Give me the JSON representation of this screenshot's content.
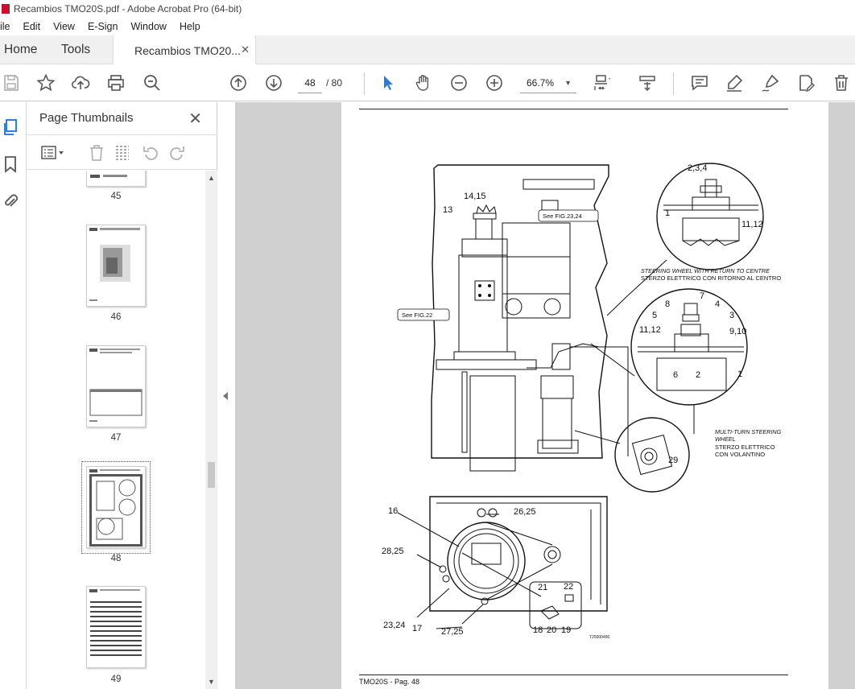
{
  "window": {
    "title": "Recambios TMO20S.pdf - Adobe Acrobat Pro (64-bit)"
  },
  "menu": [
    "ile",
    "Edit",
    "View",
    "E-Sign",
    "Window",
    "Help"
  ],
  "tabs": {
    "home": "Home",
    "tools": "Tools",
    "document": "Recambios TMO20..."
  },
  "toolbar": {
    "page_current": "48",
    "page_total": "/ 80",
    "zoom": "66.7%"
  },
  "thumbnails_panel": {
    "title": "Page Thumbnails",
    "pages": [
      "45",
      "46",
      "47",
      "48",
      "49"
    ],
    "selected": "48"
  },
  "document": {
    "footer": "TMO20S - Pag. 48",
    "refs": {
      "see_fig_23_24": "See  FIG.23,24",
      "see_fig_22": "See  FIG.22"
    },
    "captions": {
      "steering_return_en": "STEERING WHEEL WITH RETURN TO CENTRE",
      "steering_return_it": "STERZO ELETTRICO CON RITORNO AL CENTRO",
      "multi_turn_en_1": "MULTI-TURN STEERING",
      "multi_turn_en_2": "WHEEL",
      "multi_turn_it_1": "STERZO  ELETTRICO",
      "multi_turn_it_2": "CON VOLANTINO",
      "drawing_code": "T25000490"
    },
    "callouts": {
      "c14_15": "14,15",
      "c13": "13",
      "c2_3_4": "2,3,4",
      "c1a": "1",
      "c11_12a": "11,12",
      "c8": "8",
      "c7": "7",
      "c5": "5",
      "c4": "4",
      "c3": "3",
      "c11_12b": "11,12",
      "c9_10": "9,10",
      "c6": "6",
      "c2": "2",
      "c1b": "1",
      "c29": "29",
      "c16": "16",
      "c26_25": "26,25",
      "c28_25": "28,25",
      "c21": "21",
      "c22": "22",
      "c23_24": "23,24",
      "c27_25": "27,25",
      "c17": "17",
      "c18": "18",
      "c20": "20",
      "c19": "19"
    }
  }
}
